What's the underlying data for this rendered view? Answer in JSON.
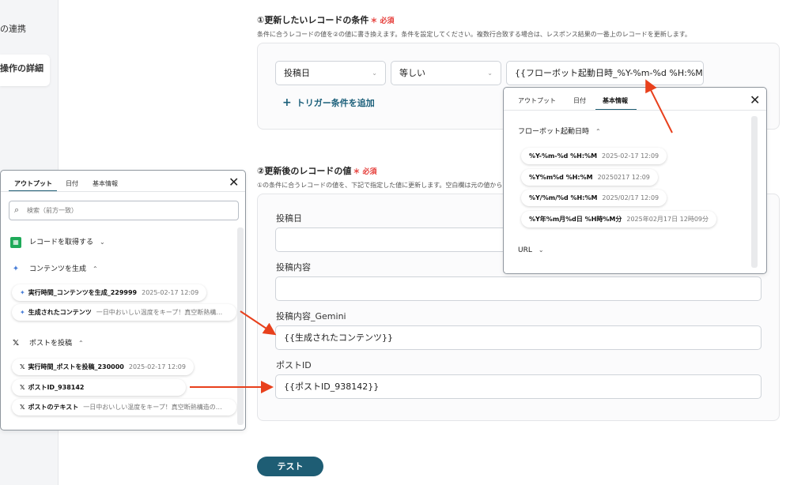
{
  "sidebar": {
    "items": [
      {
        "label": "の連携"
      },
      {
        "label": "操作の詳細"
      }
    ]
  },
  "section1": {
    "title": "①更新したいレコードの条件",
    "required": "＊ 必須",
    "desc": "条件に合うレコードの値を②の値に書き換えます。条件を設定してください。複数行合致する場合は、レスポンス結果の一番上のレコードを更新します。",
    "condition": {
      "field": "投稿日",
      "operator": "等しい",
      "value": "{{フローボット起動日時_%Y-%m-%d %H:%M}}"
    },
    "add_trigger": "トリガー条件を追加"
  },
  "section2": {
    "title": "②更新後のレコードの値",
    "required": "＊ 必須",
    "desc": "①の条件に合うレコードの値を、下記で指定した値に更新します。空白欄は元の値から更新",
    "fields": [
      {
        "label": "投稿日",
        "value": ""
      },
      {
        "label": "投稿内容",
        "value": ""
      },
      {
        "label": "投稿内容_Gemini",
        "value": "{{生成されたコンテンツ}}"
      },
      {
        "label": "ポストID",
        "value": "{{ポストID_938142}}"
      }
    ]
  },
  "test_button": "テスト",
  "left_popup": {
    "tabs": [
      "アウトプット",
      "日付",
      "基本情報"
    ],
    "close": "✕",
    "search_placeholder": "検索（前方一致）",
    "groups": [
      {
        "label": "レコードを取得する",
        "chevron": "⌄",
        "icon": "sheet-icon"
      },
      {
        "label": "コンテンツを生成",
        "chevron": "⌃",
        "icon": "gemini-icon"
      },
      {
        "label": "ポストを投稿",
        "chevron": "⌃",
        "icon": "x-icon"
      }
    ],
    "chips": [
      {
        "name": "実行時間_コンテンツを生成_229999",
        "sub": "2025-02-17 12:09",
        "icon": "gemini-icon"
      },
      {
        "name": "生成されたコンテンツ",
        "sub": "一日中おいしい温度をキープ！真空断熱構…",
        "icon": "gemini-icon"
      },
      {
        "name": "実行時間_ポストを投稿_230000",
        "sub": "2025-02-17 12:09",
        "icon": "x-icon"
      },
      {
        "name": "ポストID_938142",
        "sub": "",
        "icon": "x-icon"
      },
      {
        "name": "ポストのテキスト",
        "sub": "一日中おいしい温度をキープ！真空断熱構造の…",
        "icon": "x-icon"
      }
    ]
  },
  "right_popup": {
    "tabs": [
      "アウトプット",
      "日付",
      "基本情報"
    ],
    "close": "✕",
    "group": "フローボット起動日時",
    "group_chevron": "⌃",
    "chips": [
      {
        "name": "%Y-%m-%d %H:%M",
        "sub": "2025-02-17 12:09"
      },
      {
        "name": "%Y%m%d %H:%M",
        "sub": "20250217 12:09"
      },
      {
        "name": "%Y/%m/%d %H:%M",
        "sub": "2025/02/17 12:09"
      },
      {
        "name": "%Y年%m月%d日 %H時%M分",
        "sub": "2025年02月17日 12時09分"
      }
    ],
    "url_group": "URL",
    "url_chevron": "⌄"
  },
  "colors": {
    "accent": "#1e5d74",
    "required": "#e53935",
    "arrow": "#e8401c"
  }
}
